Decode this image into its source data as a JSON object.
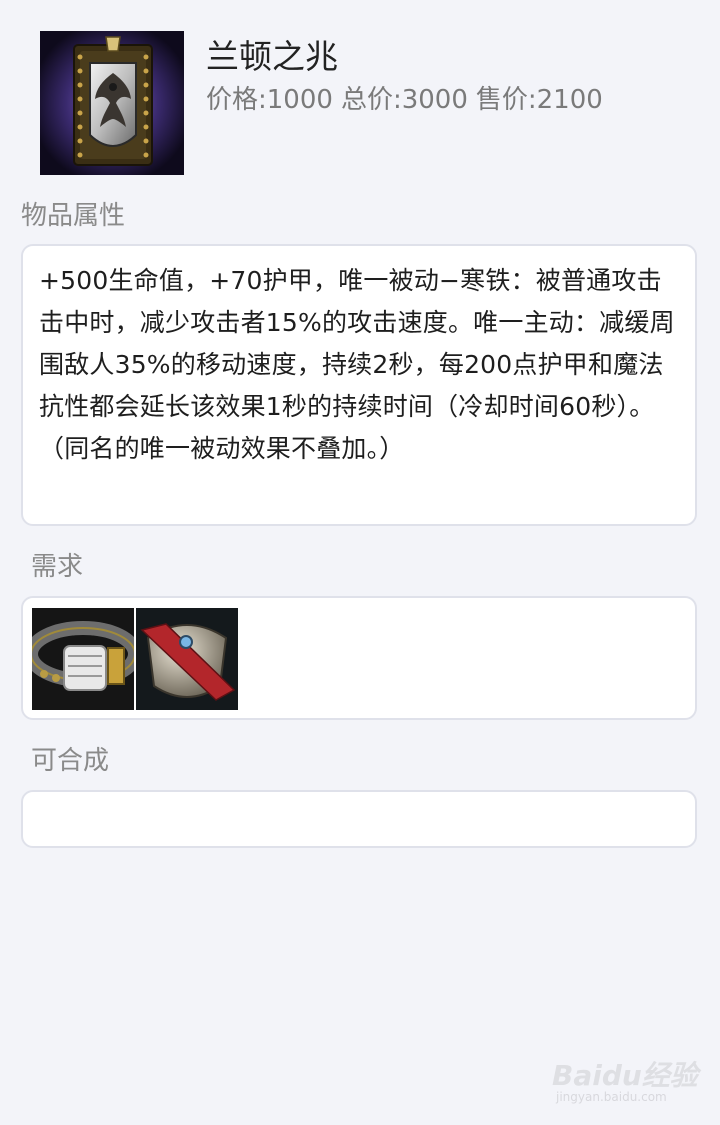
{
  "item": {
    "name": "兰顿之兆",
    "price_label": "价格:1000",
    "total_price_label": "总价:3000",
    "sell_price_label": "售价:2100",
    "icon": "randuins-omen-shield-icon"
  },
  "attributes": {
    "label": "物品属性",
    "description": "+500生命值，+70护甲，唯一被动−寒铁：被普通攻击击中时，减少攻击者15%的攻击速度。唯一主动：减缓周围敌人35%的移动速度，持续2秒，每200点护甲和魔法抗性都会延长该效果1秒的持续时间（冷却时间60秒）。（同名的唯一被动效果不叠加。）"
  },
  "requirements": {
    "label": "需求",
    "items": [
      {
        "icon": "giants-belt-icon"
      },
      {
        "icon": "warden-mail-icon"
      }
    ]
  },
  "builds_into": {
    "label": "可合成",
    "items": []
  },
  "watermark": {
    "brand": "Baidu经验",
    "url": "jingyan.baidu.com"
  },
  "colors": {
    "background": "#f3f4f9",
    "card": "#ffffff",
    "card_border": "#dfe1ea",
    "muted_text": "#8a8a8a"
  }
}
